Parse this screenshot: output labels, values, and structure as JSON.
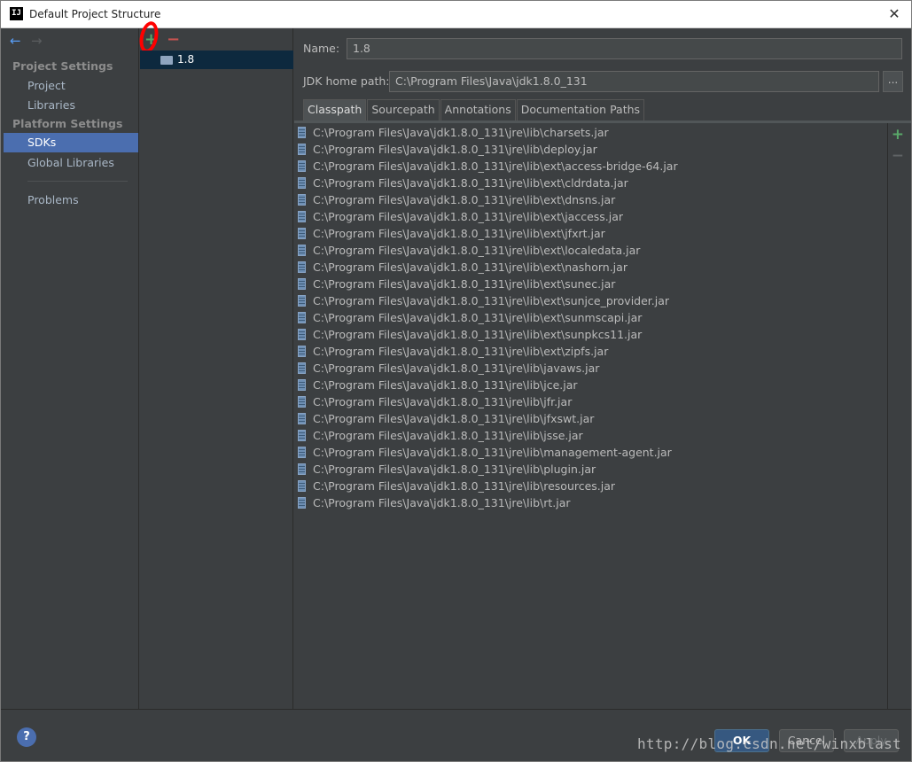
{
  "window": {
    "title": "Default Project Structure",
    "icon": "IJ",
    "close": "✕"
  },
  "sidebar": {
    "nav_back": "←",
    "nav_forward": "→",
    "groups": {
      "project_settings": "Project Settings",
      "platform_settings": "Platform Settings"
    },
    "items": {
      "project": "Project",
      "libraries": "Libraries",
      "sdks": "SDKs",
      "global_libraries": "Global Libraries",
      "problems": "Problems"
    },
    "selected": "SDKs"
  },
  "sdk_list": {
    "add": "+",
    "remove": "−",
    "items": [
      "1.8"
    ],
    "selected": "1.8"
  },
  "detail": {
    "name_label": "Name:",
    "name_value": "1.8",
    "jdk_label": "JDK home path:",
    "jdk_value": "C:\\Program Files\\Java\\jdk1.8.0_131",
    "browse": "...",
    "tabs": [
      "Classpath",
      "Sourcepath",
      "Annotations",
      "Documentation Paths"
    ],
    "active_tab": "Classpath",
    "add": "+",
    "remove": "−",
    "classpath": [
      "C:\\Program Files\\Java\\jdk1.8.0_131\\jre\\lib\\charsets.jar",
      "C:\\Program Files\\Java\\jdk1.8.0_131\\jre\\lib\\deploy.jar",
      "C:\\Program Files\\Java\\jdk1.8.0_131\\jre\\lib\\ext\\access-bridge-64.jar",
      "C:\\Program Files\\Java\\jdk1.8.0_131\\jre\\lib\\ext\\cldrdata.jar",
      "C:\\Program Files\\Java\\jdk1.8.0_131\\jre\\lib\\ext\\dnsns.jar",
      "C:\\Program Files\\Java\\jdk1.8.0_131\\jre\\lib\\ext\\jaccess.jar",
      "C:\\Program Files\\Java\\jdk1.8.0_131\\jre\\lib\\ext\\jfxrt.jar",
      "C:\\Program Files\\Java\\jdk1.8.0_131\\jre\\lib\\ext\\localedata.jar",
      "C:\\Program Files\\Java\\jdk1.8.0_131\\jre\\lib\\ext\\nashorn.jar",
      "C:\\Program Files\\Java\\jdk1.8.0_131\\jre\\lib\\ext\\sunec.jar",
      "C:\\Program Files\\Java\\jdk1.8.0_131\\jre\\lib\\ext\\sunjce_provider.jar",
      "C:\\Program Files\\Java\\jdk1.8.0_131\\jre\\lib\\ext\\sunmscapi.jar",
      "C:\\Program Files\\Java\\jdk1.8.0_131\\jre\\lib\\ext\\sunpkcs11.jar",
      "C:\\Program Files\\Java\\jdk1.8.0_131\\jre\\lib\\ext\\zipfs.jar",
      "C:\\Program Files\\Java\\jdk1.8.0_131\\jre\\lib\\javaws.jar",
      "C:\\Program Files\\Java\\jdk1.8.0_131\\jre\\lib\\jce.jar",
      "C:\\Program Files\\Java\\jdk1.8.0_131\\jre\\lib\\jfr.jar",
      "C:\\Program Files\\Java\\jdk1.8.0_131\\jre\\lib\\jfxswt.jar",
      "C:\\Program Files\\Java\\jdk1.8.0_131\\jre\\lib\\jsse.jar",
      "C:\\Program Files\\Java\\jdk1.8.0_131\\jre\\lib\\management-agent.jar",
      "C:\\Program Files\\Java\\jdk1.8.0_131\\jre\\lib\\plugin.jar",
      "C:\\Program Files\\Java\\jdk1.8.0_131\\jre\\lib\\resources.jar",
      "C:\\Program Files\\Java\\jdk1.8.0_131\\jre\\lib\\rt.jar"
    ]
  },
  "footer": {
    "help": "?",
    "ok": "OK",
    "cancel": "Cancel",
    "apply": "Apply",
    "watermark": "http://blog.csdn.net/winxblast"
  },
  "colors": {
    "background": "#3c3f41",
    "selection": "#4b6eaf",
    "add_green": "#59a869",
    "remove_red": "#c75450",
    "annotation": "#ff0000"
  },
  "icons": {
    "back": "arrow-left-icon",
    "forward": "arrow-right-icon",
    "add": "plus-icon",
    "remove": "minus-icon",
    "sdk": "folder-icon",
    "jar": "jar-icon",
    "help": "question-icon",
    "close": "close-icon"
  }
}
